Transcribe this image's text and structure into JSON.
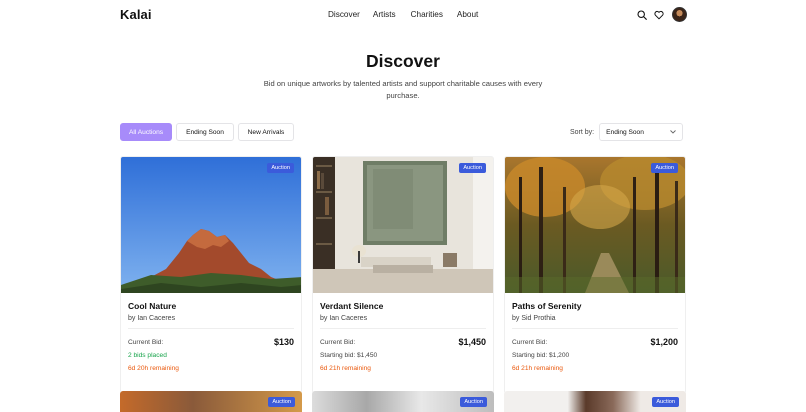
{
  "header": {
    "logo": "Kalai",
    "nav": [
      "Discover",
      "Artists",
      "Charities",
      "About"
    ],
    "icons": [
      "search-icon",
      "heart-icon",
      "avatar"
    ]
  },
  "hero": {
    "title": "Discover",
    "subtitle": "Bid on unique artworks by talented artists and support charitable causes with every purchase."
  },
  "filters": {
    "chips": [
      "All Auctions",
      "Ending Soon",
      "New Arrivals"
    ],
    "active_index": 0,
    "sort_label": "Sort by:",
    "sort_value": "Ending Soon"
  },
  "colors": {
    "accent": "#a78bfa",
    "badge": "#3b5bdb",
    "green": "#16a34a",
    "orange": "#ea580c"
  },
  "cards": [
    {
      "badge": "Auction",
      "title": "Cool Nature",
      "artist": "by Ian Caceres",
      "bid_label": "Current Bid:",
      "bid_value": "$130",
      "status": "2 bids placed",
      "remaining": "6d 20h remaining"
    },
    {
      "badge": "Auction",
      "title": "Verdant Silence",
      "artist": "by Ian Caceres",
      "bid_label": "Current Bid:",
      "bid_value": "$1,450",
      "status": "Starting bid: $1,450",
      "remaining": "6d 21h remaining"
    },
    {
      "badge": "Auction",
      "title": "Paths of Serenity",
      "artist": "by Sid Prothia",
      "bid_label": "Current Bid:",
      "bid_value": "$1,200",
      "status": "Starting bid: $1,200",
      "remaining": "6d 21h remaining"
    }
  ],
  "row2": [
    {
      "badge": "Auction"
    },
    {
      "badge": "Auction"
    },
    {
      "badge": "Auction"
    }
  ]
}
